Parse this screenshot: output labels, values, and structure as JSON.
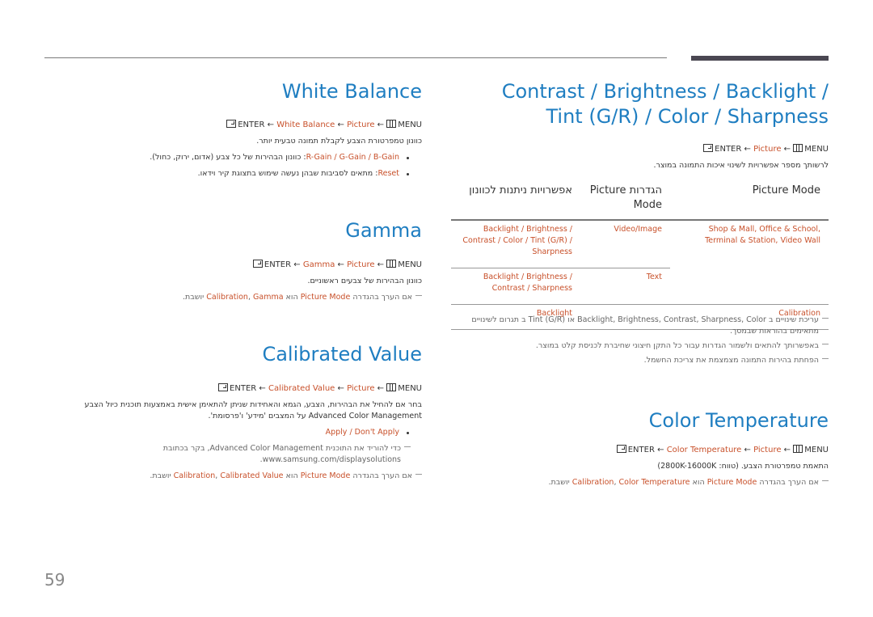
{
  "page_number": "59",
  "icons": {
    "enter": "enter-key-icon",
    "menu": "menu-icon"
  },
  "colors": {
    "heading": "#1f7ec1",
    "highlight": "#c8502a",
    "text": "#333333"
  },
  "right_column": {
    "title_line1": "/ Contrast / Brightness / Backlight",
    "title_line2": "Tint (G/R) / Color / Sharpness",
    "path": {
      "menu": "MENU",
      "picture": "Picture",
      "enter": "ENTER",
      "arrow": "←"
    },
    "description": "לרשותך מספר אפשרויות לשינוי איכות התמונה במוצר.",
    "table": {
      "headers": [
        "Picture Mode",
        "הגדרות Picture Mode",
        "אפשרויות ניתנות לכוונון"
      ],
      "rows": [
        {
          "mode": "Shop & Mall, Office & School, Terminal & Station, Video Wall",
          "setting": "Video/Image",
          "options": "Backlight / Brightness / Contrast / Color / Tint (G/R) / Sharpness"
        },
        {
          "mode": "",
          "setting": "Text",
          "options": "Backlight / Brightness / Contrast / Sharpness"
        },
        {
          "mode": "Calibration",
          "setting": "",
          "options": "Backlight"
        }
      ]
    },
    "notes": [
      "עריכת שינויים ב Backlight, Brightness, Contrast, Sharpness, Color או Tint (G/R) ב תגרום לשינויים מתאימים בהוראות שבמסך.",
      "באפשרותך להתאים ולשמור הגדרות עבור כל התקן חיצוני שחיברת לכניסת קלט במוצר.",
      "הפחתת בהירות התמונה מצמצמת את צריכת החשמל."
    ],
    "color_temperature": {
      "title": "Color Temperature",
      "path_item": "Color Temperature",
      "description": "התאמת טמפרטורת הצבע. (טווח: 2800K-16000K)",
      "note": {
        "pre": "אם הערך בהגדרה ",
        "a": "Picture Mode",
        "mid": " הוא ",
        "b": "Calibration",
        "sep": ", ",
        "c": "Color Temperature",
        "post": " יושבת."
      }
    }
  },
  "left_column": {
    "white_balance": {
      "title": "White Balance",
      "path_item": "White Balance",
      "description": "כוונון טמפרטורת הצבע לקבלת תמונה טבעית יותר.",
      "bullet1": {
        "items": "R-Gain / G-Gain / B-Gain",
        "text": ": כוונון הבהירות של כל צבע (אדום, ירוק, כחול)."
      },
      "bullet2": {
        "item": "Reset",
        "text": ": מתאים לסביבות שבהן נעשה שימוש בתצוגת קיר וידאו."
      }
    },
    "gamma": {
      "title": "Gamma",
      "path_item": "Gamma",
      "description": "כוונון הבהירות של צבעים ראשוניים.",
      "note": {
        "pre": "אם הערך בהגדרה ",
        "a": "Picture Mode",
        "mid": " הוא ",
        "b": "Calibration",
        "sep": ", ",
        "c": "Gamma",
        "post": " יושבת."
      }
    },
    "calibrated_value": {
      "title": "Calibrated Value",
      "path_item": "Calibrated Value",
      "description": "בחר אם להחיל את הבהירות, הצבע, הגמא והאחידות שניתן להתאימן אישית באמצעות תוכנית כיול הצבע Advanced Color Management על המצבים 'מידע' ו'פרסומת'.",
      "bullet": "Apply / Don't Apply",
      "note1": "כדי להוריד את התוכנית Advanced Color Management, בקר בכתובת www.samsung.com/displaysolutions.",
      "note2": {
        "pre": "אם הערך בהגדרה ",
        "a": "Picture Mode",
        "mid": " הוא ",
        "b": "Calibration",
        "sep": ", ",
        "c": "Calibrated Value",
        "post": " יושבת."
      }
    }
  }
}
